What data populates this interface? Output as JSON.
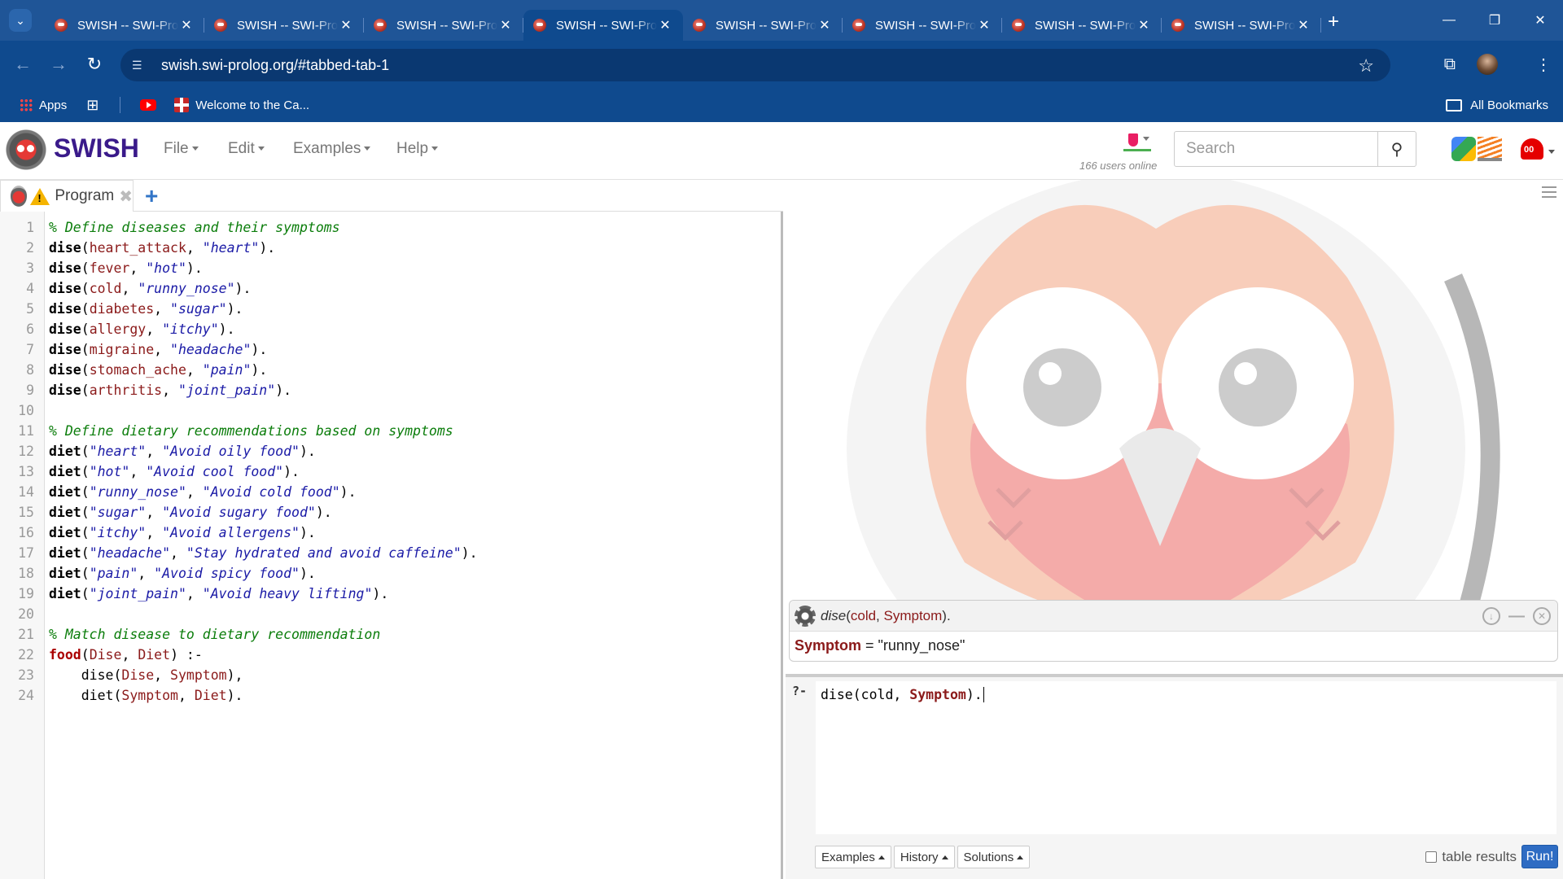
{
  "browser": {
    "tabs": [
      {
        "title": "SWISH -- SWI-Prolog for SHaring",
        "close": "✕"
      },
      {
        "title": "SWISH -- SWI-Prolog for SHaring",
        "close": "✕"
      },
      {
        "title": "SWISH -- SWI-Prolog for SHaring",
        "close": "✕"
      },
      {
        "title": "SWISH -- SWI-Prolog for SHaring",
        "close": "✕",
        "active": true
      },
      {
        "title": "SWISH -- SWI-Prolog for SHaring",
        "close": "✕"
      },
      {
        "title": "SWISH -- SWI-Prolog for SHaring",
        "close": "✕"
      },
      {
        "title": "SWISH -- SWI-Prolog for SHaring",
        "close": "✕"
      },
      {
        "title": "SWISH -- SWI-Prolog for SHaring",
        "close": "✕"
      }
    ],
    "new_tab": "+",
    "url": "swish.swi-prolog.org/#tabbed-tab-1",
    "bookmarks": [
      {
        "label": "Apps",
        "icon": "apps-grid-icon"
      },
      {
        "label": "",
        "icon": "tab-groups-icon"
      },
      {
        "label": "",
        "icon": "youtube-icon"
      },
      {
        "label": "Welcome to the Ca...",
        "icon": "cross-shield-icon"
      }
    ],
    "all_bookmarks": "All Bookmarks",
    "colors": {
      "frame": "#1f5597",
      "toolbar": "#0f4a8e",
      "active_tab": "#0f4a8e"
    }
  },
  "swish": {
    "brand": "SWISH",
    "menus": [
      "File",
      "Edit",
      "Examples",
      "Help"
    ],
    "online": "166 users online",
    "search_placeholder": "Search",
    "notify_count": "00",
    "editor_tab": "Program",
    "code": [
      [
        {
          "c": "cm",
          "t": "% Define diseases and their symptoms"
        }
      ],
      [
        {
          "c": "kw",
          "t": "dise"
        },
        {
          "c": "",
          "t": "("
        },
        {
          "c": "at",
          "t": "heart_attack"
        },
        {
          "c": "",
          "t": ", "
        },
        {
          "c": "st",
          "t": "\"heart\""
        },
        {
          "c": "",
          "t": ")."
        }
      ],
      [
        {
          "c": "kw",
          "t": "dise"
        },
        {
          "c": "",
          "t": "("
        },
        {
          "c": "at",
          "t": "fever"
        },
        {
          "c": "",
          "t": ", "
        },
        {
          "c": "st",
          "t": "\"hot\""
        },
        {
          "c": "",
          "t": ")."
        }
      ],
      [
        {
          "c": "kw",
          "t": "dise"
        },
        {
          "c": "",
          "t": "("
        },
        {
          "c": "at",
          "t": "cold"
        },
        {
          "c": "",
          "t": ", "
        },
        {
          "c": "st",
          "t": "\"runny_nose\""
        },
        {
          "c": "",
          "t": ")."
        }
      ],
      [
        {
          "c": "kw",
          "t": "dise"
        },
        {
          "c": "",
          "t": "("
        },
        {
          "c": "at",
          "t": "diabetes"
        },
        {
          "c": "",
          "t": ", "
        },
        {
          "c": "st",
          "t": "\"sugar\""
        },
        {
          "c": "",
          "t": ")."
        }
      ],
      [
        {
          "c": "kw",
          "t": "dise"
        },
        {
          "c": "",
          "t": "("
        },
        {
          "c": "at",
          "t": "allergy"
        },
        {
          "c": "",
          "t": ", "
        },
        {
          "c": "st",
          "t": "\"itchy\""
        },
        {
          "c": "",
          "t": ")."
        }
      ],
      [
        {
          "c": "kw",
          "t": "dise"
        },
        {
          "c": "",
          "t": "("
        },
        {
          "c": "at",
          "t": "migraine"
        },
        {
          "c": "",
          "t": ", "
        },
        {
          "c": "st",
          "t": "\"headache\""
        },
        {
          "c": "",
          "t": ")."
        }
      ],
      [
        {
          "c": "kw",
          "t": "dise"
        },
        {
          "c": "",
          "t": "("
        },
        {
          "c": "at",
          "t": "stomach_ache"
        },
        {
          "c": "",
          "t": ", "
        },
        {
          "c": "st",
          "t": "\"pain\""
        },
        {
          "c": "",
          "t": ")."
        }
      ],
      [
        {
          "c": "kw",
          "t": "dise"
        },
        {
          "c": "",
          "t": "("
        },
        {
          "c": "at",
          "t": "arthritis"
        },
        {
          "c": "",
          "t": ", "
        },
        {
          "c": "st",
          "t": "\"joint_pain\""
        },
        {
          "c": "",
          "t": ")."
        }
      ],
      [],
      [
        {
          "c": "cm",
          "t": "% Define dietary recommendations based on symptoms"
        }
      ],
      [
        {
          "c": "kw",
          "t": "diet"
        },
        {
          "c": "",
          "t": "("
        },
        {
          "c": "st",
          "t": "\"heart\""
        },
        {
          "c": "",
          "t": ", "
        },
        {
          "c": "st",
          "t": "\"Avoid oily food\""
        },
        {
          "c": "",
          "t": ")."
        }
      ],
      [
        {
          "c": "kw",
          "t": "diet"
        },
        {
          "c": "",
          "t": "("
        },
        {
          "c": "st",
          "t": "\"hot\""
        },
        {
          "c": "",
          "t": ", "
        },
        {
          "c": "st",
          "t": "\"Avoid cool food\""
        },
        {
          "c": "",
          "t": ")."
        }
      ],
      [
        {
          "c": "kw",
          "t": "diet"
        },
        {
          "c": "",
          "t": "("
        },
        {
          "c": "st",
          "t": "\"runny_nose\""
        },
        {
          "c": "",
          "t": ", "
        },
        {
          "c": "st",
          "t": "\"Avoid cold food\""
        },
        {
          "c": "",
          "t": ")."
        }
      ],
      [
        {
          "c": "kw",
          "t": "diet"
        },
        {
          "c": "",
          "t": "("
        },
        {
          "c": "st",
          "t": "\"sugar\""
        },
        {
          "c": "",
          "t": ", "
        },
        {
          "c": "st",
          "t": "\"Avoid sugary food\""
        },
        {
          "c": "",
          "t": ")."
        }
      ],
      [
        {
          "c": "kw",
          "t": "diet"
        },
        {
          "c": "",
          "t": "("
        },
        {
          "c": "st",
          "t": "\"itchy\""
        },
        {
          "c": "",
          "t": ", "
        },
        {
          "c": "st",
          "t": "\"Avoid allergens\""
        },
        {
          "c": "",
          "t": ")."
        }
      ],
      [
        {
          "c": "kw",
          "t": "diet"
        },
        {
          "c": "",
          "t": "("
        },
        {
          "c": "st",
          "t": "\"headache\""
        },
        {
          "c": "",
          "t": ", "
        },
        {
          "c": "st",
          "t": "\"Stay hydrated and avoid caffeine\""
        },
        {
          "c": "",
          "t": ")."
        }
      ],
      [
        {
          "c": "kw",
          "t": "diet"
        },
        {
          "c": "",
          "t": "("
        },
        {
          "c": "st",
          "t": "\"pain\""
        },
        {
          "c": "",
          "t": ", "
        },
        {
          "c": "st",
          "t": "\"Avoid spicy food\""
        },
        {
          "c": "",
          "t": ")."
        }
      ],
      [
        {
          "c": "kw",
          "t": "diet"
        },
        {
          "c": "",
          "t": "("
        },
        {
          "c": "st",
          "t": "\"joint_pain\""
        },
        {
          "c": "",
          "t": ", "
        },
        {
          "c": "st",
          "t": "\"Avoid heavy lifting\""
        },
        {
          "c": "",
          "t": ")."
        }
      ],
      [],
      [
        {
          "c": "cm",
          "t": "% Match disease to dietary recommendation"
        }
      ],
      [
        {
          "c": "hd",
          "t": "food"
        },
        {
          "c": "",
          "t": "("
        },
        {
          "c": "vr",
          "t": "Dise"
        },
        {
          "c": "",
          "t": ", "
        },
        {
          "c": "vr",
          "t": "Diet"
        },
        {
          "c": "",
          "t": ") :-"
        }
      ],
      [
        {
          "c": "",
          "t": "    dise("
        },
        {
          "c": "vr",
          "t": "Dise"
        },
        {
          "c": "",
          "t": ", "
        },
        {
          "c": "vr",
          "t": "Symptom"
        },
        {
          "c": "",
          "t": "),"
        }
      ],
      [
        {
          "c": "",
          "t": "    diet("
        },
        {
          "c": "vr",
          "t": "Symptom"
        },
        {
          "c": "",
          "t": ", "
        },
        {
          "c": "vr",
          "t": "Diet"
        },
        {
          "c": "",
          "t": ")."
        }
      ]
    ],
    "answer": {
      "query_pred": "dise",
      "query_rest_a": "(",
      "query_arg1": "cold",
      "query_sep": ", ",
      "query_arg2": "Symptom",
      "query_end": ").",
      "var": "Symptom",
      "eq": " = ",
      "value": "\"runny_nose\""
    },
    "query": {
      "prompt": "?-",
      "text_a": "dise(cold, ",
      "text_var": "Symptom",
      "text_b": ")."
    },
    "buttons": {
      "examples": "Examples",
      "history": "History",
      "solutions": "Solutions",
      "table": "table results",
      "run": "Run!"
    }
  }
}
